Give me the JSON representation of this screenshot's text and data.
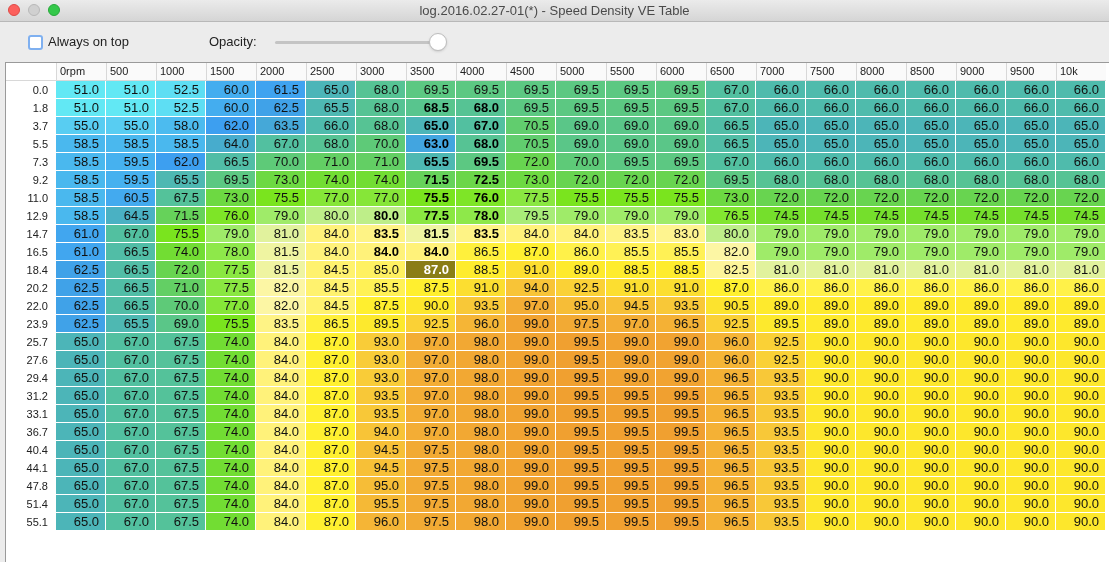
{
  "window": {
    "title": "log.2016.02.27-01(*) - Speed Density VE Table"
  },
  "always_on_top": {
    "label": "Always on top",
    "checked": false
  },
  "opacity": {
    "label": "Opacity:",
    "level": 1
  },
  "table": {
    "columns": [
      "0rpm",
      "500",
      "1000",
      "1500",
      "2000",
      "2500",
      "3000",
      "3500",
      "4000",
      "4500",
      "5000",
      "5500",
      "6000",
      "6500",
      "7000",
      "7500",
      "8000",
      "8500",
      "9000",
      "9500",
      "10k"
    ],
    "rows": [
      {
        "label": "0.0",
        "cells": [
          "51.0",
          "51.0",
          "52.5",
          "60.0",
          "61.5",
          "65.0",
          "68.0",
          "69.5",
          "69.5",
          "69.5",
          "69.5",
          "69.5",
          "69.5",
          "67.0",
          "66.0",
          "66.0",
          "66.0",
          "66.0",
          "66.0",
          "66.0",
          "66.0"
        ]
      },
      {
        "label": "1.8",
        "cells": [
          "51.0",
          "51.0",
          "52.5",
          "60.0",
          "62.5",
          "65.5",
          "68.0",
          {
            "value": "68.5",
            "kind": "bold"
          },
          {
            "value": "68.0",
            "kind": "bold"
          },
          "69.5",
          "69.5",
          "69.5",
          "69.5",
          "67.0",
          "66.0",
          "66.0",
          "66.0",
          "66.0",
          "66.0",
          "66.0",
          "66.0"
        ]
      },
      {
        "label": "3.7",
        "cells": [
          "55.0",
          "55.0",
          "58.0",
          "62.0",
          "63.5",
          "66.0",
          "68.0",
          {
            "value": "65.0",
            "kind": "bold"
          },
          {
            "value": "67.0",
            "kind": "bold"
          },
          "70.5",
          "69.0",
          "69.0",
          "69.0",
          "66.5",
          "65.0",
          "65.0",
          "65.0",
          "65.0",
          "65.0",
          "65.0",
          "65.0"
        ]
      },
      {
        "label": "5.5",
        "cells": [
          "58.5",
          "58.5",
          "58.5",
          "64.0",
          "67.0",
          "68.0",
          "70.0",
          {
            "value": "63.0",
            "kind": "bold"
          },
          {
            "value": "68.0",
            "kind": "bold"
          },
          "70.5",
          "69.0",
          "69.0",
          "69.0",
          "66.5",
          "65.0",
          "65.0",
          "65.0",
          "65.0",
          "65.0",
          "65.0",
          "65.0"
        ]
      },
      {
        "label": "7.3",
        "cells": [
          "58.5",
          "59.5",
          "62.0",
          "66.5",
          "70.0",
          "71.0",
          "71.0",
          {
            "value": "65.5",
            "kind": "bold"
          },
          {
            "value": "69.5",
            "kind": "bold"
          },
          "72.0",
          "70.0",
          "69.5",
          "69.5",
          "67.0",
          "66.0",
          "66.0",
          "66.0",
          "66.0",
          "66.0",
          "66.0",
          "66.0"
        ]
      },
      {
        "label": "9.2",
        "cells": [
          "58.5",
          "59.5",
          "65.5",
          "69.5",
          "73.0",
          "74.0",
          "74.0",
          {
            "value": "71.5",
            "kind": "bold"
          },
          {
            "value": "72.5",
            "kind": "bold"
          },
          "73.0",
          "72.0",
          "72.0",
          "72.0",
          "69.5",
          "68.0",
          "68.0",
          "68.0",
          "68.0",
          "68.0",
          "68.0",
          "68.0"
        ]
      },
      {
        "label": "11.0",
        "cells": [
          "58.5",
          "60.5",
          "67.5",
          "73.0",
          "75.5",
          "77.0",
          "77.0",
          {
            "value": "75.5",
            "kind": "bold"
          },
          {
            "value": "76.0",
            "kind": "bold"
          },
          "77.5",
          "75.5",
          "75.5",
          "75.5",
          "73.0",
          "72.0",
          "72.0",
          "72.0",
          "72.0",
          "72.0",
          "72.0",
          "72.0"
        ]
      },
      {
        "label": "12.9",
        "cells": [
          "58.5",
          "64.5",
          "71.5",
          "76.0",
          "79.0",
          "80.0",
          {
            "value": "80.0",
            "kind": "bold"
          },
          {
            "value": "77.5",
            "kind": "bold"
          },
          {
            "value": "78.0",
            "kind": "bold"
          },
          "79.5",
          "79.0",
          "79.0",
          "79.0",
          "76.5",
          "74.5",
          "74.5",
          "74.5",
          "74.5",
          "74.5",
          "74.5",
          "74.5"
        ]
      },
      {
        "label": "14.7",
        "cells": [
          "61.0",
          "67.0",
          "75.5",
          "79.0",
          "81.0",
          "84.0",
          {
            "value": "83.5",
            "kind": "bold"
          },
          {
            "value": "81.5",
            "kind": "bold"
          },
          {
            "value": "83.5",
            "kind": "bold"
          },
          "84.0",
          "84.0",
          "83.5",
          "83.0",
          "80.0",
          "79.0",
          "79.0",
          "79.0",
          "79.0",
          "79.0",
          "79.0",
          "79.0"
        ]
      },
      {
        "label": "16.5",
        "cells": [
          "61.0",
          "66.5",
          "74.0",
          "78.0",
          "81.5",
          "84.0",
          {
            "value": "84.0",
            "kind": "bold"
          },
          {
            "value": "84.0",
            "kind": "bold"
          },
          "86.5",
          "87.0",
          "86.0",
          "85.5",
          "85.5",
          "82.0",
          "79.0",
          "79.0",
          "79.0",
          "79.0",
          "79.0",
          "79.0",
          "79.0"
        ]
      },
      {
        "label": "18.4",
        "cells": [
          "62.5",
          "66.5",
          "72.0",
          "77.5",
          "81.5",
          "84.5",
          "85.0",
          {
            "value": "87.0",
            "kind": "current"
          },
          "88.5",
          "91.0",
          "89.0",
          "88.5",
          "88.5",
          "82.5",
          "81.0",
          "81.0",
          "81.0",
          "81.0",
          "81.0",
          "81.0",
          "81.0"
        ]
      },
      {
        "label": "20.2",
        "cells": [
          "62.5",
          "66.5",
          "71.0",
          "77.5",
          "82.0",
          "84.5",
          "85.5",
          "87.5",
          "91.0",
          "94.0",
          "92.5",
          "91.0",
          "91.0",
          "87.0",
          "86.0",
          "86.0",
          "86.0",
          "86.0",
          "86.0",
          "86.0",
          "86.0"
        ]
      },
      {
        "label": "22.0",
        "cells": [
          "62.5",
          "66.5",
          "70.0",
          "77.0",
          "82.0",
          "84.5",
          "87.5",
          "90.0",
          "93.5",
          "97.0",
          "95.0",
          "94.5",
          "93.5",
          "90.5",
          "89.0",
          "89.0",
          "89.0",
          "89.0",
          "89.0",
          "89.0",
          "89.0"
        ]
      },
      {
        "label": "23.9",
        "cells": [
          "62.5",
          "65.5",
          "69.0",
          "75.5",
          "83.5",
          "86.5",
          "89.5",
          "92.5",
          "96.0",
          "99.0",
          "97.5",
          "97.0",
          "96.5",
          "92.5",
          "89.5",
          "89.0",
          "89.0",
          "89.0",
          "89.0",
          "89.0",
          "89.0"
        ]
      },
      {
        "label": "25.7",
        "cells": [
          "65.0",
          "67.0",
          "67.5",
          "74.0",
          "84.0",
          "87.0",
          "93.0",
          "97.0",
          "98.0",
          "99.0",
          "99.5",
          "99.0",
          "99.0",
          "96.0",
          "92.5",
          "90.0",
          "90.0",
          "90.0",
          "90.0",
          "90.0",
          "90.0"
        ]
      },
      {
        "label": "27.6",
        "cells": [
          "65.0",
          "67.0",
          "67.5",
          "74.0",
          "84.0",
          "87.0",
          "93.0",
          "97.0",
          "98.0",
          "99.0",
          "99.5",
          "99.0",
          "99.0",
          "96.0",
          "92.5",
          "90.0",
          "90.0",
          "90.0",
          "90.0",
          "90.0",
          "90.0"
        ]
      },
      {
        "label": "29.4",
        "cells": [
          "65.0",
          "67.0",
          "67.5",
          "74.0",
          "84.0",
          "87.0",
          "93.0",
          "97.0",
          "98.0",
          "99.0",
          "99.5",
          "99.0",
          "99.0",
          "96.5",
          "93.5",
          "90.0",
          "90.0",
          "90.0",
          "90.0",
          "90.0",
          "90.0"
        ]
      },
      {
        "label": "31.2",
        "cells": [
          "65.0",
          "67.0",
          "67.5",
          "74.0",
          "84.0",
          "87.0",
          "93.5",
          "97.0",
          "98.0",
          "99.0",
          "99.5",
          "99.5",
          "99.5",
          "96.5",
          "93.5",
          "90.0",
          "90.0",
          "90.0",
          "90.0",
          "90.0",
          "90.0"
        ]
      },
      {
        "label": "33.1",
        "cells": [
          "65.0",
          "67.0",
          "67.5",
          "74.0",
          "84.0",
          "87.0",
          "93.5",
          "97.0",
          "98.0",
          "99.0",
          "99.5",
          "99.5",
          "99.5",
          "96.5",
          "93.5",
          "90.0",
          "90.0",
          "90.0",
          "90.0",
          "90.0",
          "90.0"
        ]
      },
      {
        "label": "36.7",
        "cells": [
          "65.0",
          "67.0",
          "67.5",
          "74.0",
          "84.0",
          "87.0",
          "94.0",
          "97.0",
          "98.0",
          "99.0",
          "99.5",
          "99.5",
          "99.5",
          "96.5",
          "93.5",
          "90.0",
          "90.0",
          "90.0",
          "90.0",
          "90.0",
          "90.0"
        ]
      },
      {
        "label": "40.4",
        "cells": [
          "65.0",
          "67.0",
          "67.5",
          "74.0",
          "84.0",
          "87.0",
          "94.5",
          "97.5",
          "98.0",
          "99.0",
          "99.5",
          "99.5",
          "99.5",
          "96.5",
          "93.5",
          "90.0",
          "90.0",
          "90.0",
          "90.0",
          "90.0",
          "90.0"
        ]
      },
      {
        "label": "44.1",
        "cells": [
          "65.0",
          "67.0",
          "67.5",
          "74.0",
          "84.0",
          "87.0",
          "94.5",
          "97.5",
          "98.0",
          "99.0",
          "99.5",
          "99.5",
          "99.5",
          "96.5",
          "93.5",
          "90.0",
          "90.0",
          "90.0",
          "90.0",
          "90.0",
          "90.0"
        ]
      },
      {
        "label": "47.8",
        "cells": [
          "65.0",
          "67.0",
          "67.5",
          "74.0",
          "84.0",
          "87.0",
          "95.0",
          "97.5",
          "98.0",
          "99.0",
          "99.5",
          "99.5",
          "99.5",
          "96.5",
          "93.5",
          "90.0",
          "90.0",
          "90.0",
          "90.0",
          "90.0",
          "90.0"
        ]
      },
      {
        "label": "51.4",
        "cells": [
          "65.0",
          "67.0",
          "67.5",
          "74.0",
          "84.0",
          "87.0",
          "95.5",
          "97.5",
          "98.0",
          "99.0",
          "99.5",
          "99.5",
          "99.5",
          "96.5",
          "93.5",
          "90.0",
          "90.0",
          "90.0",
          "90.0",
          "90.0",
          "90.0"
        ]
      },
      {
        "label": "55.1",
        "cells": [
          "65.0",
          "67.0",
          "67.5",
          "74.0",
          "84.0",
          "87.0",
          "96.0",
          "97.5",
          "98.0",
          "99.0",
          "99.5",
          "99.5",
          "99.5",
          "96.5",
          "93.5",
          "90.0",
          "90.0",
          "90.0",
          "90.0",
          "90.0",
          "90.0"
        ]
      }
    ]
  }
}
